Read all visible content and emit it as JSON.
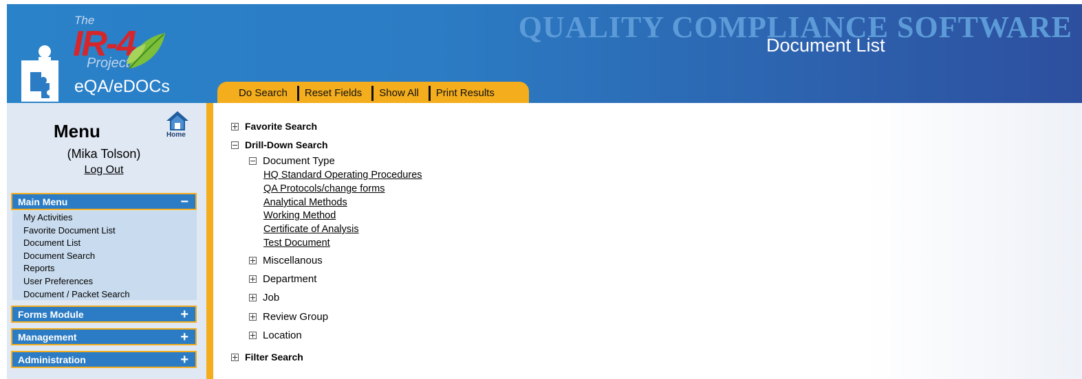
{
  "header": {
    "logo": {
      "the": "The",
      "ir4": "IR-4",
      "project": "Project",
      "product": "eQA/eDOCs"
    },
    "brand": "QUALITY COMPLIANCE SOFTWARE",
    "page_title": "Document List",
    "toolbar": [
      "Do Search",
      "Reset Fields",
      "Show All",
      "Print Results"
    ]
  },
  "sidebar": {
    "title": "Menu",
    "home_label": "Home",
    "user": "(Mika Tolson)",
    "logout": "Log Out",
    "sections": [
      {
        "label": "Main Menu",
        "toggle": "−",
        "expanded": true
      },
      {
        "label": "Forms Module",
        "toggle": "+",
        "expanded": false
      },
      {
        "label": "Management",
        "toggle": "+",
        "expanded": false
      },
      {
        "label": "Administration",
        "toggle": "+",
        "expanded": false
      }
    ],
    "main_menu_items": [
      "My Activities",
      "Favorite Document List",
      "Document List",
      "Document Search",
      "Reports",
      "User Preferences",
      "Document / Packet Search"
    ]
  },
  "tree": {
    "favorite_search": "Favorite Search",
    "drill_down_search": "Drill-Down Search",
    "document_type": "Document Type",
    "document_type_links": [
      "HQ Standard Operating Procedures",
      "QA Protocols/change forms",
      "Analytical Methods",
      "Working Method",
      "Certificate of Analysis",
      "Test Document"
    ],
    "categories": [
      "Miscellanous",
      "Department",
      "Job",
      "Review Group",
      "Location"
    ],
    "filter_search": "Filter Search"
  },
  "colors": {
    "header_blue": "#2b7cc4",
    "accent_orange": "#f4ad1c",
    "sidebar_bg": "#dfe8f3",
    "logo_red": "#d5262b"
  },
  "icons": [
    "user-puzzle-icon",
    "leaf-icon",
    "home-icon",
    "plus-expander-icon",
    "minus-expander-icon"
  ]
}
